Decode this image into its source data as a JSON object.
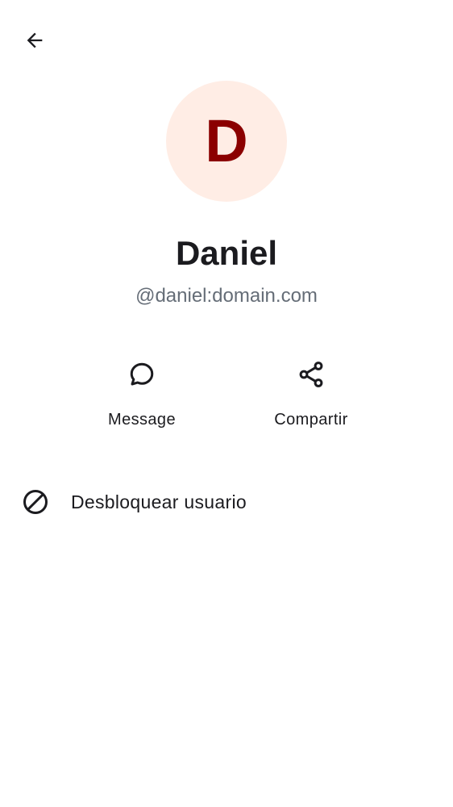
{
  "toolbar": {
    "back_icon": "arrow-back-icon"
  },
  "profile": {
    "avatar_letter": "D",
    "avatar_bg": "#ffede5",
    "avatar_fg": "#8b0000",
    "display_name": "Daniel",
    "user_id": "@daniel:domain.com"
  },
  "actions": [
    {
      "label": "Message",
      "icon": "chat-bubble-icon"
    },
    {
      "label": "Compartir",
      "icon": "share-icon"
    }
  ],
  "menu": [
    {
      "label": "Desbloquear usuario",
      "icon": "block-icon"
    }
  ]
}
